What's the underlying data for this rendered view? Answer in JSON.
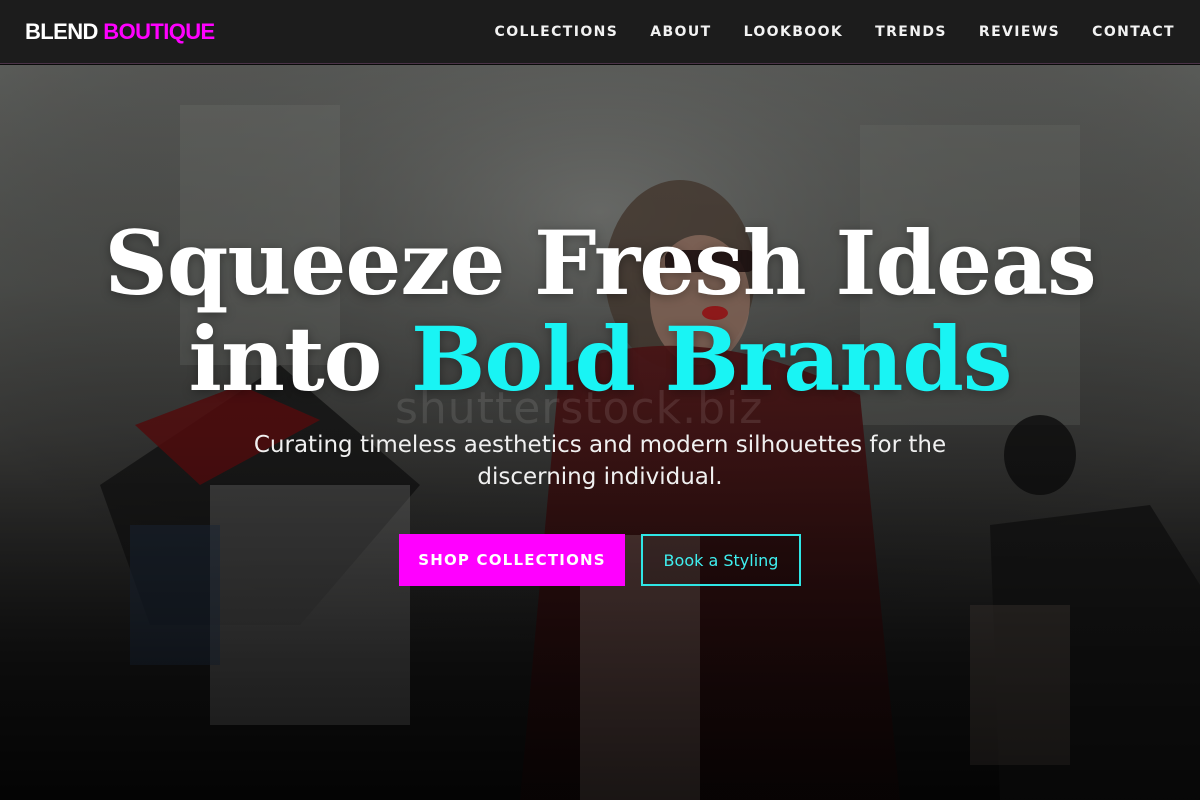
{
  "brand": {
    "name_part1": "BLEND",
    "name_part2": "BOUTIQUE",
    "accent_color": "#ff00ff"
  },
  "nav": {
    "items": [
      {
        "label": "COLLECTIONS"
      },
      {
        "label": "ABOUT"
      },
      {
        "label": "LOOKBOOK"
      },
      {
        "label": "TRENDS"
      },
      {
        "label": "REVIEWS"
      },
      {
        "label": "CONTACT"
      }
    ]
  },
  "hero": {
    "headline_line1": "Squeeze Fresh Ideas",
    "headline_line2_plain": "into",
    "headline_line2_accent": "Bold Brands",
    "accent_color": "#19f4f4",
    "subtitle": "Curating timeless aesthetics and modern silhouettes for the discerning individual.",
    "watermark": "shutterstock.biz",
    "primary_cta": "SHOP COLLECTIONS",
    "primary_cta_color": "#ff00ff",
    "secondary_cta": "Book a Styling",
    "secondary_cta_color": "#2fe6e6"
  }
}
